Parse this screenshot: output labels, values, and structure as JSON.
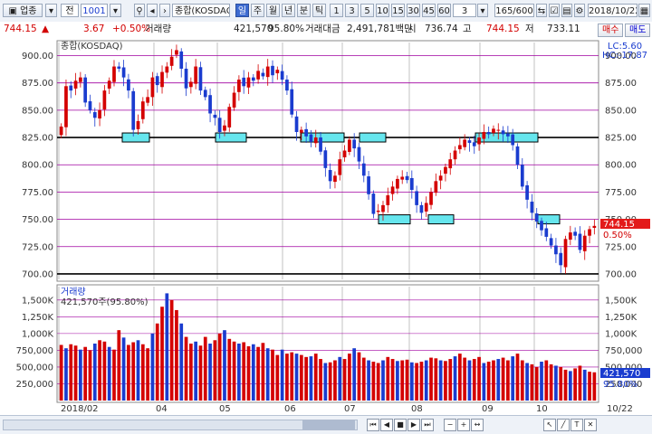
{
  "toolbar": {
    "sector_label": "업종",
    "view_label": "전",
    "code": "1001",
    "name": "종합(KOSDAQ)",
    "periods": [
      "일",
      "주",
      "월",
      "년",
      "분",
      "틱"
    ],
    "active_period": "일",
    "intervals": [
      "1",
      "3",
      "5",
      "10",
      "15",
      "30",
      "45",
      "60"
    ],
    "interval_select": "3",
    "count": "165/600",
    "date": "2018/10/22"
  },
  "quote": {
    "price": "744.15",
    "change_arrow": "▲",
    "change": "3.67",
    "change_pct": "+0.50%",
    "volume_label": "거래량",
    "volume": "421,570",
    "volume_ratio": "95.80%",
    "amount_label": "거래대금",
    "amount": "2,491,781백만",
    "open_label": "시",
    "open": "736.74",
    "high_label": "고",
    "high": "744.15",
    "low_label": "저",
    "low": "733.11",
    "buy_label": "매수",
    "sell_label": "매도"
  },
  "price_pane": {
    "legend": "종합(KOSDAQ)",
    "lc": "LC:5.60",
    "hc": "HC:-17.87",
    "last_label": "744.15",
    "last_pct": "0.50%"
  },
  "volume_pane": {
    "title": "거래량",
    "value": "421,570주(95.80%)",
    "last_label": "421,570",
    "last_pct": "95.80%"
  },
  "colors": {
    "up": "#d40000",
    "down": "#1a3ccf",
    "support_box": "#66e6ee",
    "grid_h": "#a000a0",
    "grid_v": "#9a9a9a",
    "price_tag": "#e31a1a"
  },
  "chart_data": [
    {
      "type": "candlestick",
      "title": "종합(KOSDAQ)",
      "x_tick_labels": [
        "2018/02",
        "04",
        "05",
        "06",
        "07",
        "08",
        "09",
        "10",
        "10/22"
      ],
      "y_ticks": [
        700,
        725,
        750,
        775,
        800,
        825,
        850,
        875,
        900
      ],
      "ylim": [
        695,
        912
      ],
      "horizontal_lines": [
        825,
        700
      ],
      "support_resistance_levels": [
        825,
        750
      ],
      "closes": [
        835,
        872,
        868,
        877,
        880,
        857,
        850,
        843,
        850,
        868,
        877,
        890,
        888,
        880,
        868,
        832,
        840,
        858,
        862,
        880,
        873,
        885,
        890,
        899,
        905,
        888,
        870,
        876,
        890,
        868,
        862,
        847,
        843,
        830,
        836,
        853,
        866,
        878,
        872,
        880,
        877,
        886,
        881,
        890,
        882,
        887,
        878,
        868,
        846,
        830,
        832,
        826,
        821,
        825,
        812,
        797,
        785,
        790,
        805,
        813,
        823,
        815,
        803,
        790,
        773,
        755,
        758,
        763,
        772,
        780,
        787,
        789,
        786,
        777,
        763,
        756,
        765,
        775,
        785,
        790,
        798,
        805,
        813,
        818,
        823,
        820,
        817,
        825,
        830,
        828,
        833,
        832,
        828,
        826,
        818,
        800,
        780,
        768,
        756,
        748,
        740,
        734,
        726,
        718,
        708,
        732,
        738,
        735,
        722,
        735,
        741,
        744
      ],
      "close_last": 744.15
    },
    {
      "type": "bar",
      "title": "거래량",
      "y_tick_labels": [
        "250,000",
        "500,000",
        "750,000",
        "1,000K",
        "1,250K",
        "1,500K"
      ],
      "ylim": [
        0,
        1700000
      ],
      "values": [
        830000,
        780000,
        840000,
        820000,
        760000,
        800000,
        750000,
        850000,
        900000,
        880000,
        800000,
        760000,
        1050000,
        940000,
        830000,
        870000,
        900000,
        840000,
        780000,
        1000000,
        1150000,
        1400000,
        1600000,
        1500000,
        1350000,
        1150000,
        950000,
        850000,
        880000,
        820000,
        950000,
        850000,
        900000,
        1000000,
        1050000,
        920000,
        880000,
        850000,
        870000,
        810000,
        840000,
        800000,
        860000,
        780000,
        760000,
        680000,
        760000,
        700000,
        720000,
        700000,
        680000,
        650000,
        660000,
        700000,
        620000,
        560000,
        570000,
        600000,
        650000,
        620000,
        700000,
        780000,
        720000,
        640000,
        600000,
        580000,
        560000,
        600000,
        650000,
        620000,
        590000,
        600000,
        610000,
        570000,
        560000,
        580000,
        600000,
        640000,
        630000,
        600000,
        590000,
        620000,
        660000,
        700000,
        640000,
        600000,
        620000,
        650000,
        560000,
        580000,
        600000,
        620000,
        640000,
        600000,
        660000,
        700000,
        600000,
        560000,
        540000,
        500000,
        580000,
        600000,
        540000,
        520000,
        500000,
        460000,
        440000,
        480000,
        520000,
        460000,
        430000,
        421570
      ],
      "last_value": 421570
    }
  ]
}
